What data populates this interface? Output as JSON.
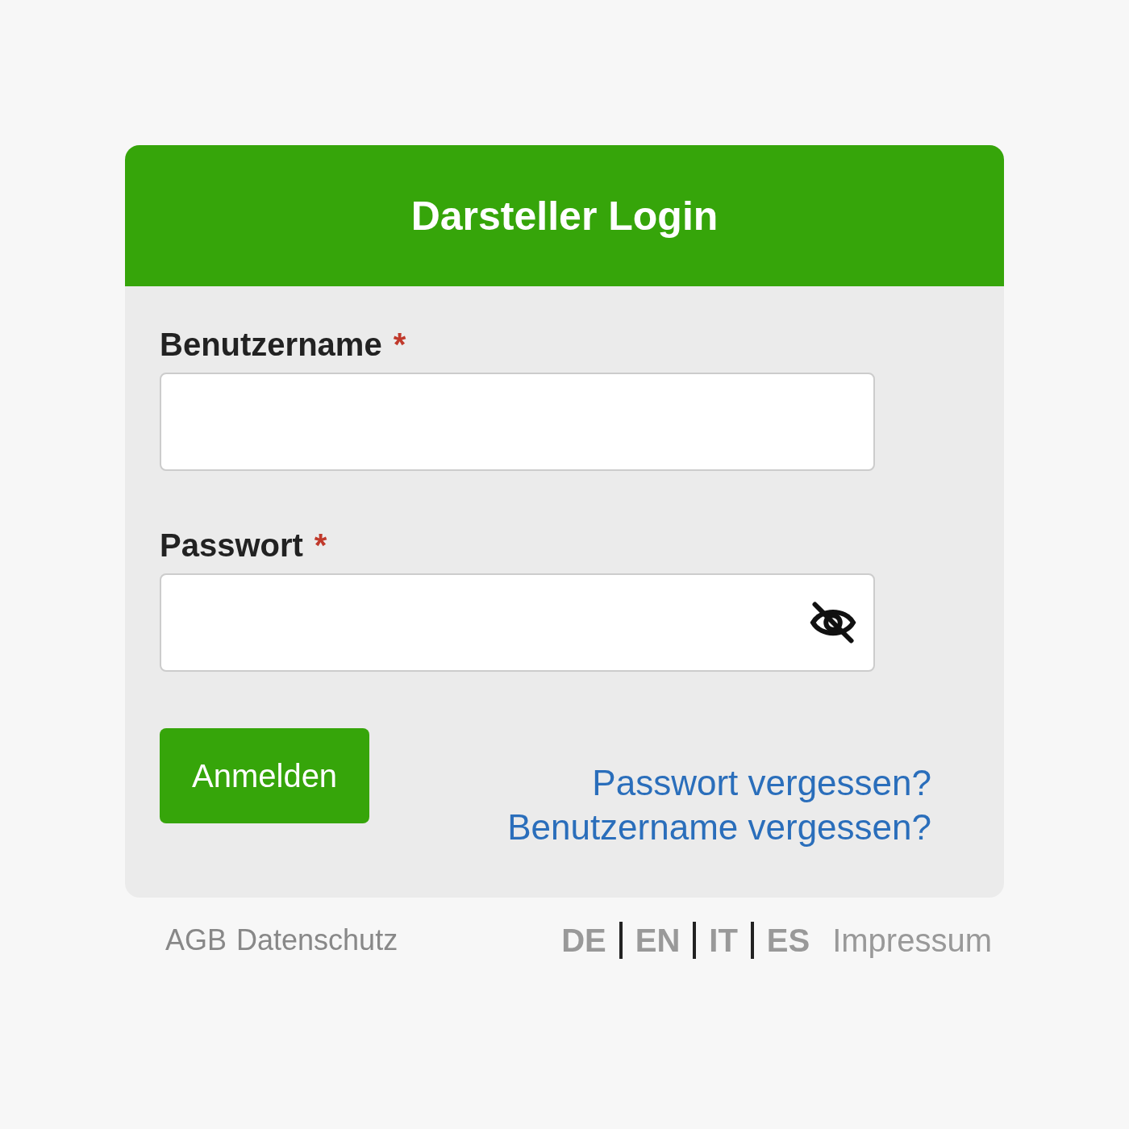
{
  "card": {
    "title": "Darsteller Login"
  },
  "fields": [
    {
      "label": "Benutzername",
      "required_mark": "*",
      "kind": "text"
    },
    {
      "label": "Passwort",
      "required_mark": "*",
      "kind": "password"
    }
  ],
  "submit": "Anmelden",
  "links": [
    "Passwort vergessen?",
    "Benutzername vergessen?"
  ],
  "footer": {
    "left_links": [
      "AGB",
      "Datenschutz"
    ],
    "languages": [
      "DE",
      "EN",
      "IT",
      "ES"
    ],
    "imprint": "Impressum"
  }
}
